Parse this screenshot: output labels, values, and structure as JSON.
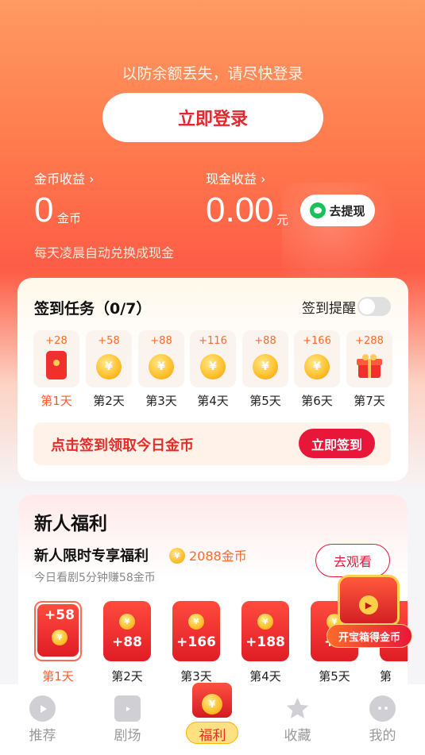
{
  "header": {
    "tip": "以防余额丢失，请尽快登录",
    "login_button": "立即登录"
  },
  "earnings": {
    "coin_label": "金币收益",
    "coin_value": "0",
    "coin_unit": "金币",
    "cash_label": "现金收益",
    "cash_value": "0.00",
    "cash_unit": "元",
    "withdraw_button": "去提现",
    "auto_note": "每天凌晨自动兑换成现金"
  },
  "signin": {
    "title": "签到任务（0/7）",
    "reminder_label": "签到提醒",
    "reminder_on": false,
    "days": [
      {
        "amount": "+28",
        "label": "第1天",
        "icon": "red-packet-icon"
      },
      {
        "amount": "+58",
        "label": "第2天",
        "icon": "coin-icon"
      },
      {
        "amount": "+88",
        "label": "第3天",
        "icon": "coin-icon"
      },
      {
        "amount": "+116",
        "label": "第4天",
        "icon": "coin-icon"
      },
      {
        "amount": "+88",
        "label": "第5天",
        "icon": "coin-icon"
      },
      {
        "amount": "+166",
        "label": "第6天",
        "icon": "coin-icon"
      },
      {
        "amount": "+288",
        "label": "第7天",
        "icon": "gift-box-icon"
      }
    ],
    "bar_text": "点击签到领取今日金币",
    "sign_button": "立即签到"
  },
  "newbie": {
    "title": "新人福利",
    "subtitle": "新人限时专享福利",
    "coins": "2088金币",
    "note": "今日看剧5分钟赚58金币",
    "watch_button": "去观看",
    "packets": [
      {
        "amount": "+58",
        "label": "第1天"
      },
      {
        "amount": "+88",
        "label": "第2天"
      },
      {
        "amount": "+166",
        "label": "第3天"
      },
      {
        "amount": "+188",
        "label": "第4天"
      },
      {
        "amount": "+1",
        "label": "第5天"
      },
      {
        "amount": "",
        "label": "第"
      }
    ],
    "chest_label": "开宝箱得金币"
  },
  "coin_symbol": "¥",
  "tabbar": {
    "tabs": [
      {
        "label": "推荐",
        "icon": "play-icon"
      },
      {
        "label": "剧场",
        "icon": "tv-icon"
      },
      {
        "label": "福利",
        "icon": "red-packet-icon"
      },
      {
        "label": "收藏",
        "icon": "star-icon"
      },
      {
        "label": "我的",
        "icon": "profile-icon"
      }
    ]
  },
  "colors": {
    "accent": "#e8173a",
    "orange": "#ff6a2b",
    "coin": "#ffbf2b"
  }
}
